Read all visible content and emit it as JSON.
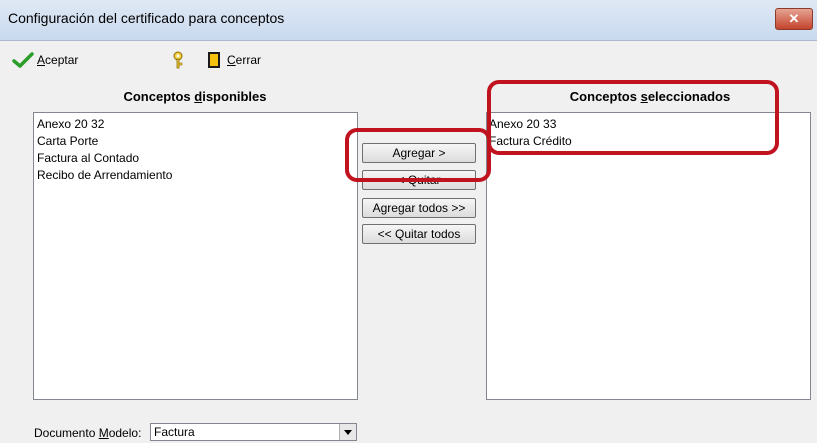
{
  "window": {
    "title": "Configuración del certificado para conceptos",
    "close_label": "✕"
  },
  "toolbar": {
    "accept_label": "Aceptar",
    "close_label": "Cerrar"
  },
  "available": {
    "header_prefix": "Conceptos ",
    "header_mnemonic": "d",
    "header_suffix": "isponibles",
    "items": [
      "Anexo 20 32",
      "Carta Porte",
      "Factura al Contado",
      "Recibo de Arrendamiento"
    ]
  },
  "selected": {
    "header_prefix": "Conceptos ",
    "header_mnemonic": "s",
    "header_suffix": "eleccionados",
    "items": [
      "Anexo 20 33",
      "Factura Crédito"
    ]
  },
  "buttons": {
    "add": "Agregar >",
    "remove": "< Quitar",
    "add_all": "Agregar todos >>",
    "remove_all": "<< Quitar todos"
  },
  "footer": {
    "model_label_prefix": "Documento ",
    "model_label_mnemonic": "M",
    "model_label_suffix": "odelo:",
    "model_value": "Factura"
  },
  "colors": {
    "highlight": "#c1121f",
    "accept_check": "#2a9d2a"
  }
}
